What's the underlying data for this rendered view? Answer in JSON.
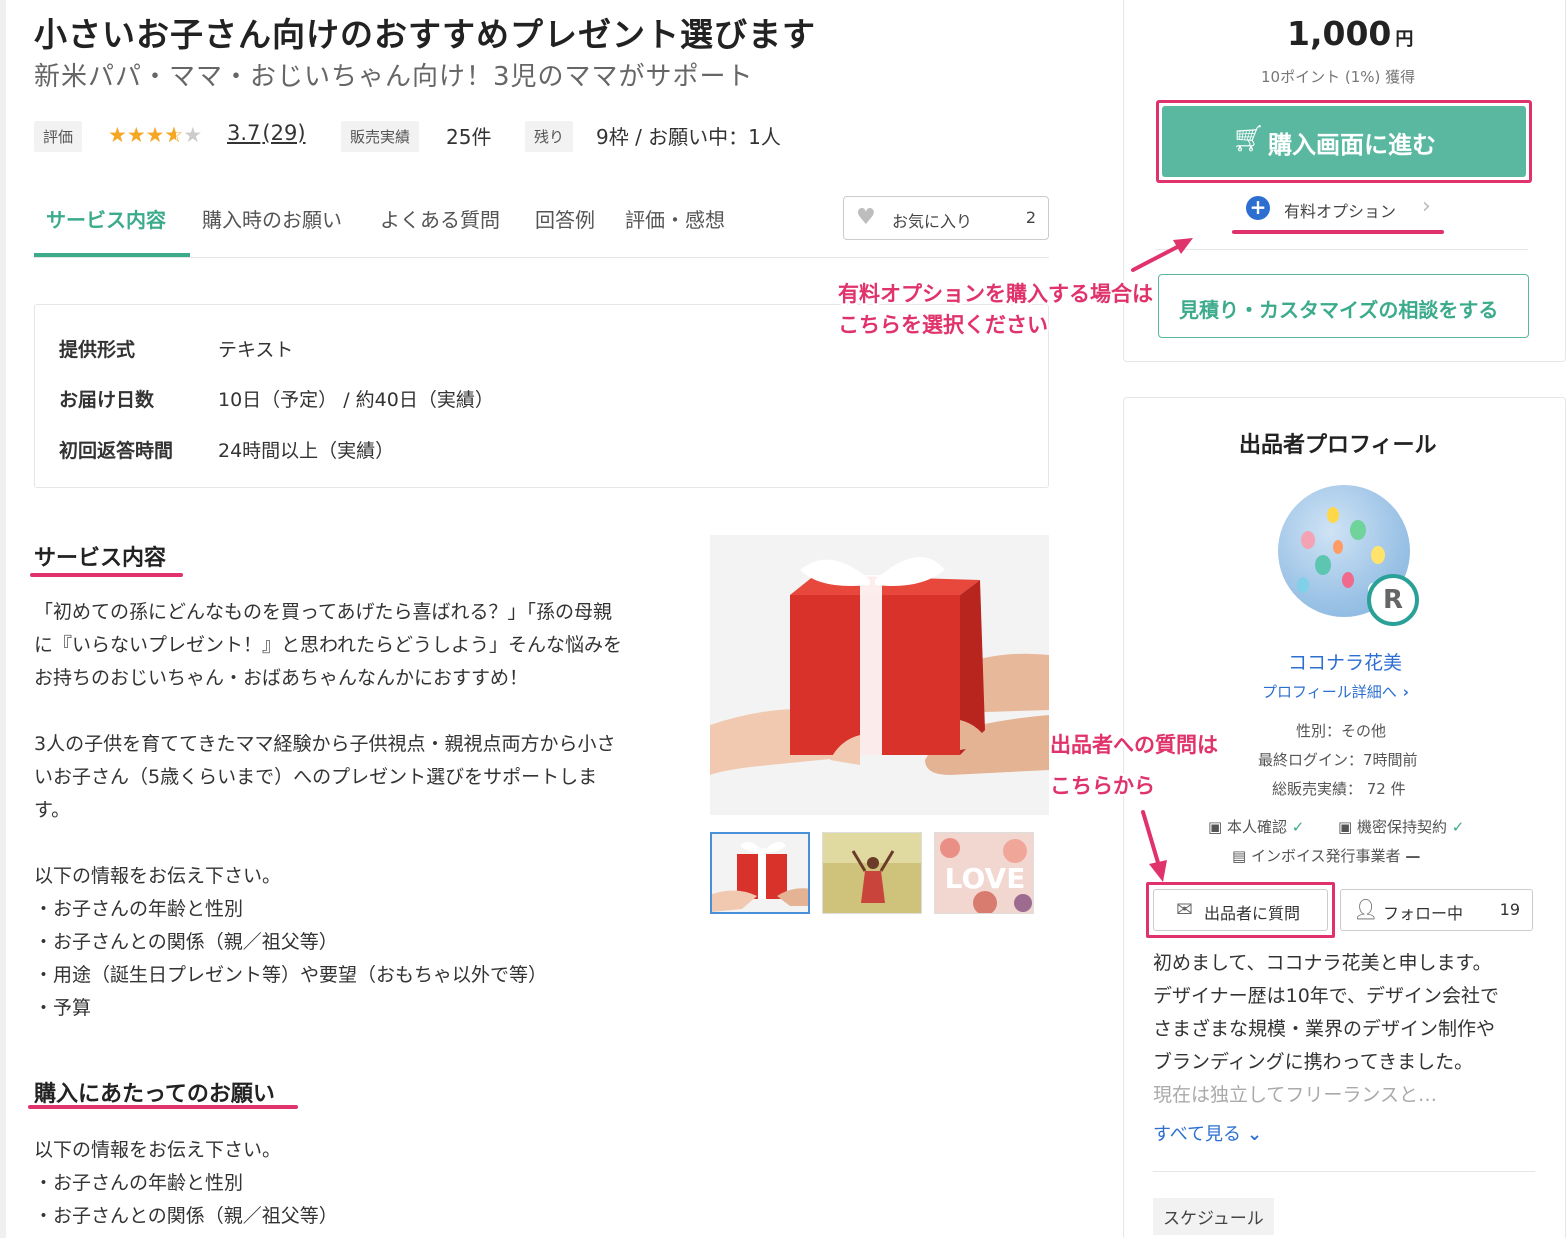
{
  "service": {
    "title": "小さいお子さん向けのおすすめプレゼント選びます",
    "subtitle": "新米パパ・ママ・おじいちゃん向け！3児のママがサポート"
  },
  "stats": {
    "rating_tag": "評価",
    "rating_value": 3.7,
    "rating_text": "3.7",
    "rating_count": "(29)",
    "sales_tag": "販売実績",
    "sales_value": "25件",
    "remaining_tag": "残り",
    "remaining_value": "9枠 / お願い中：1人"
  },
  "tabs": [
    {
      "label": "サービス内容",
      "active": true
    },
    {
      "label": "購入時のお願い",
      "active": false
    },
    {
      "label": "よくある質問",
      "active": false
    },
    {
      "label": "回答例",
      "active": false
    },
    {
      "label": "評価・感想",
      "active": false
    }
  ],
  "favorite": {
    "label": "お気に入り",
    "count": "2",
    "icon": "heart-icon"
  },
  "specs": [
    {
      "key": "提供形式",
      "value": "テキスト"
    },
    {
      "key": "お届け日数",
      "value": "10日（予定） / 約40日（実績）"
    },
    {
      "key": "初回返答時間",
      "value": "24時間以上（実績）"
    }
  ],
  "section_service": {
    "heading": "サービス内容",
    "lines": [
      "「初めての孫にどんなものを買ってあげたら喜ばれる？」「孫の母親",
      "に『いらないプレゼント！』と思われたらどうしよう」そんな悩みを",
      "お持ちのおじいちゃん・おばあちゃんなんかにおすすめ！",
      "",
      "3人の子供を育ててきたママ経験から子供視点・親視点両方から小さ",
      "いお子さん（5歳くらいまで）へのプレゼント選びをサポートしま",
      "す。",
      "",
      "以下の情報をお伝え下さい。",
      "・お子さんの年齢と性別",
      "・お子さんとの関係（親／祖父等）",
      "・用途（誕生日プレゼント等）や要望（おもちゃ以外で等）",
      "・予算"
    ]
  },
  "section_request": {
    "heading": "購入にあたってのお願い",
    "lines": [
      "以下の情報をお伝え下さい。",
      "・お子さんの年齢と性別",
      "・お子さんとの関係（親／祖父等）"
    ]
  },
  "purchase": {
    "price": "1,000",
    "currency": "円",
    "points": "10ポイント (1%) 獲得",
    "buy_label": "購入画面に進む",
    "option_label": "有料オプション",
    "consult_label": "見積り・カスタマイズの相談をする"
  },
  "annotations": {
    "option_note_line1": "有料オプションを購入する場合は",
    "option_note_line2": "こちらを選択ください",
    "question_note_line1": "出品者への質問は",
    "question_note_line2": "こちらから"
  },
  "profile": {
    "heading": "出品者プロフィール",
    "rank_badge": "R",
    "name": "ココナラ花美",
    "detail_link": "プロフィール詳細へ",
    "gender": "性別：その他",
    "last_login": "最終ログイン：7時間前",
    "total_sales": "総販売実績： 72 件",
    "verify_identity": "本人確認",
    "verify_nda": "機密保持契約",
    "invoice": "インボイス発行事業者",
    "question_label": "出品者に質問",
    "follow_label": "フォロー中",
    "follow_count": "19",
    "bio_lines": [
      "初めまして、ココナラ花美と申します。",
      "デザイナー歴は10年で、デザイン会社で",
      "さまざまな規模・業界のデザイン制作や",
      "ブランディングに携わってきました。"
    ],
    "bio_faded": "現在は独立してフリーランスと…",
    "see_all": "すべて見る",
    "schedule_tag": "スケジュール"
  },
  "colors": {
    "accent_green": "#3bab8c",
    "buy_button": "#5ab8a1",
    "link_blue": "#2c6fd1",
    "annotation_pink": "#e0336b",
    "star": "#f5a623"
  }
}
